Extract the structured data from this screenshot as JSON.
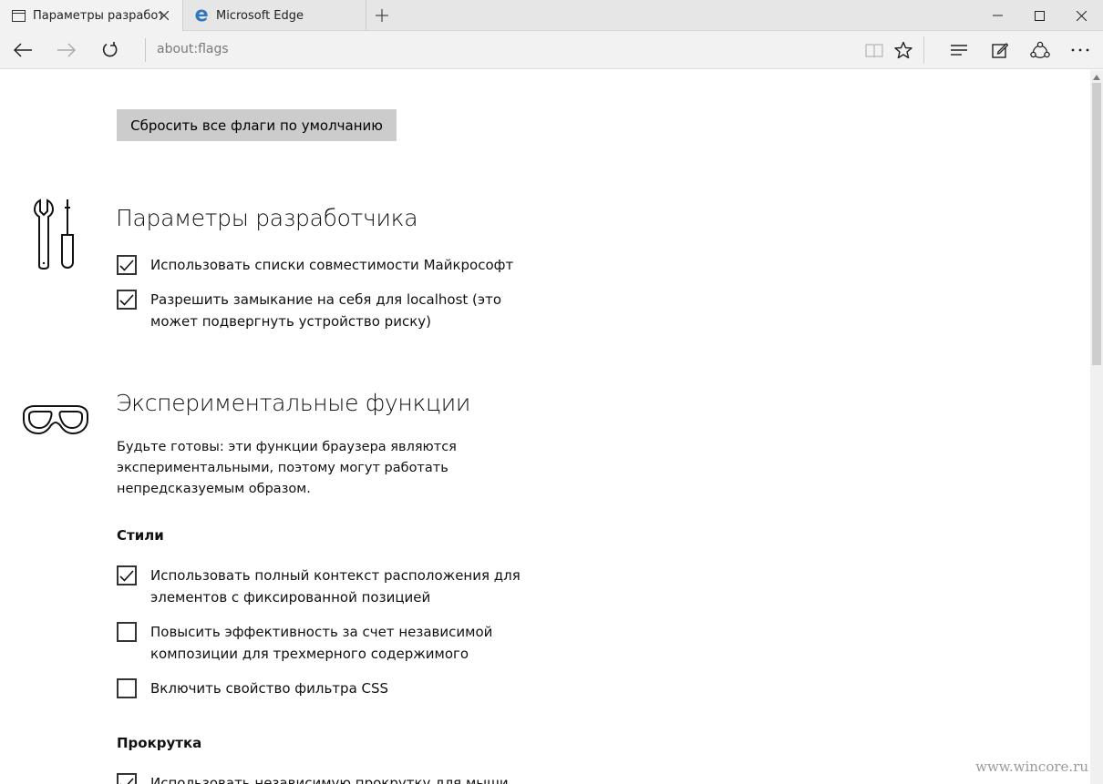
{
  "tabs": [
    {
      "title": "Параметры разработчика",
      "icon": "page-icon"
    },
    {
      "title": "Microsoft Edge",
      "icon": "edge-logo-icon"
    }
  ],
  "nav": {
    "address": "about:flags"
  },
  "content": {
    "reset_button": "Сбросить все флаги по умолчанию",
    "developer": {
      "title": "Параметры разработчика",
      "icon": "tools-icon",
      "options": [
        {
          "label": "Использовать списки совместимости Майкрософт",
          "checked": true
        },
        {
          "label": "Разрешить замыкание на себя для localhost (это может подвергнуть устройство риску)",
          "checked": true
        }
      ]
    },
    "experimental": {
      "title": "Экспериментальные функции",
      "icon": "goggles-icon",
      "description": "Будьте готовы: эти функции браузера являются экспериментальными, поэтому могут работать непредсказуемым образом.",
      "styles_heading": "Стили",
      "styles_options": [
        {
          "label": "Использовать полный контекст расположения для элементов с фиксированной позицией",
          "checked": true
        },
        {
          "label": "Повысить эффективность за счет независимой композиции для трехмерного содержимого",
          "checked": false
        },
        {
          "label": "Включить свойство фильтра CSS",
          "checked": false
        }
      ],
      "scroll_heading": "Прокрутка",
      "scroll_options": [
        {
          "label": "Использовать независимую прокрутку для мыши",
          "checked": true
        }
      ]
    }
  },
  "watermark": "www.wincore.ru",
  "colors": {
    "tab_active_bg": "#f2f2f2",
    "tabstrip_bg": "#e6e6e6",
    "button_bg": "#cccccc",
    "edge_blue": "#3277bc"
  }
}
